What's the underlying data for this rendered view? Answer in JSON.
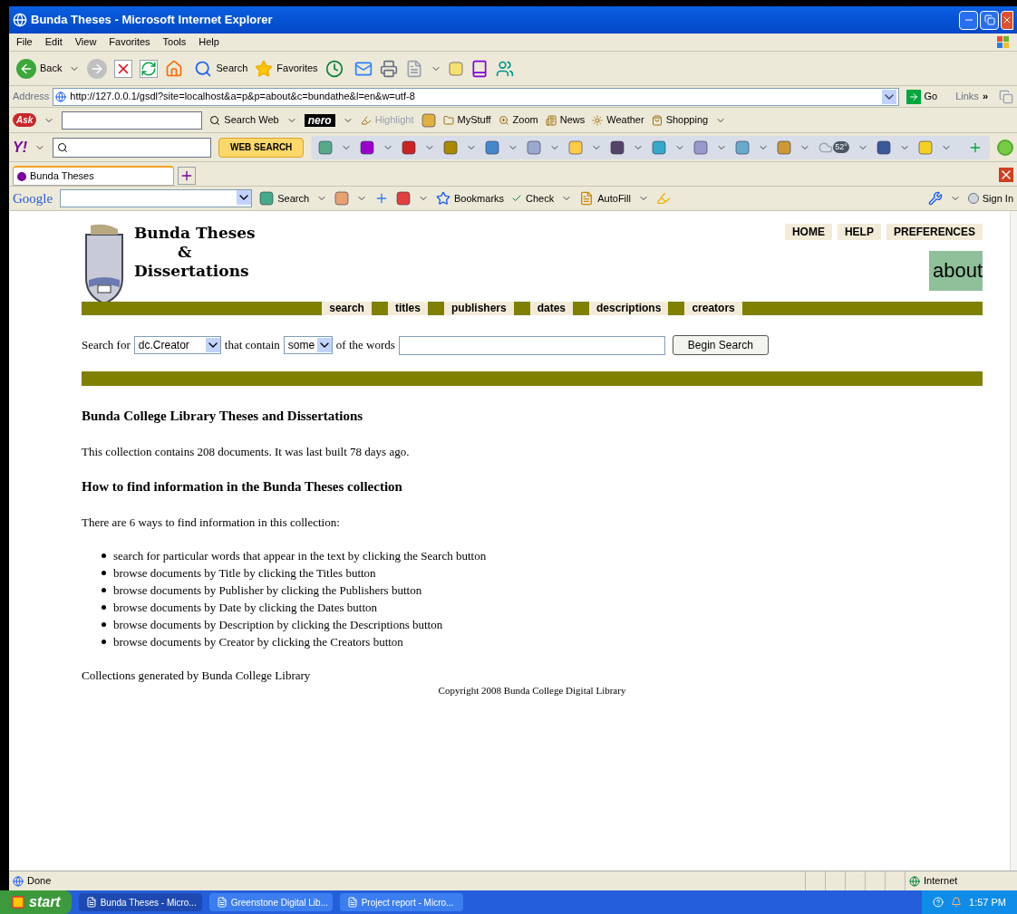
{
  "window": {
    "title": "Bunda Theses - Microsoft Internet Explorer"
  },
  "menu": [
    "File",
    "Edit",
    "View",
    "Favorites",
    "Tools",
    "Help"
  ],
  "toolbar": {
    "back": "Back",
    "search": "Search",
    "favorites": "Favorites"
  },
  "address": {
    "label": "Address",
    "url": "http://127.0.0.1/gsdl?site=localhost&a=p&p=about&c=bundathe&l=en&w=utf-8",
    "go": "Go",
    "links": "Links",
    "links_more": "»"
  },
  "ask_bar": {
    "logo": "Ask",
    "search_web": "Search Web",
    "nero": "nero",
    "items": [
      {
        "label": "Highlight",
        "disabled": true
      },
      {
        "label": "MyStuff",
        "disabled": false
      },
      {
        "label": "Zoom",
        "disabled": false
      },
      {
        "label": "News",
        "disabled": false
      },
      {
        "label": "Weather",
        "disabled": false
      },
      {
        "label": "Shopping",
        "disabled": false
      }
    ]
  },
  "yahoo_bar": {
    "logo": "Y!",
    "button": "WEB SEARCH",
    "temperature": "52°"
  },
  "tabs": [
    {
      "label": "Bunda Theses",
      "selected": true
    }
  ],
  "google_bar": {
    "logo": "Google",
    "search": "Search",
    "bookmarks": "Bookmarks",
    "check": "Check",
    "autofill": "AutoFill",
    "sign_in": "Sign In"
  },
  "page": {
    "logo_lines": [
      "Bunda Theses",
      "&",
      "Dissertations"
    ],
    "top_links": [
      "HOME",
      "HELP",
      "PREFERENCES"
    ],
    "page_title": "about",
    "nav": [
      "search",
      "titles",
      "publishers",
      "dates",
      "descriptions",
      "creators"
    ],
    "search_form": {
      "search_for": "Search for",
      "field": "dc.Creator",
      "that_contain": "that contain",
      "mode": "some",
      "of_the_words": "of the words",
      "button": "Begin Search"
    },
    "heading": "Bunda College Library Theses and Dissertations",
    "summary": "This collection contains 208 documents. It was last built 78 days ago.",
    "subheading": "How to find information in the Bunda Theses collection",
    "intro": "There are 6 ways to find information in this collection:",
    "ways": [
      "search for particular words that appear in the text by clicking the Search button",
      "browse documents by Title by clicking the Titles button",
      "browse documents by Publisher by clicking the Publishers button",
      "browse documents by Date by clicking the Dates button",
      "browse documents by Description by clicking the Descriptions button",
      "browse documents by Creator by clicking the Creators button"
    ],
    "generated": "Collections generated by Bunda College Library",
    "copyright": "Copyright 2008 Bunda College Digital Library"
  },
  "status_bar": {
    "text": "Done",
    "zone": "Internet"
  },
  "taskbar": {
    "start": "start",
    "tasks": [
      {
        "label": "Bunda Theses - Micro...",
        "selected": true
      },
      {
        "label": "Greenstone Digital Lib...",
        "selected": false
      },
      {
        "label": "Project report - Micro...",
        "selected": false
      }
    ],
    "time": "1:57 PM"
  }
}
